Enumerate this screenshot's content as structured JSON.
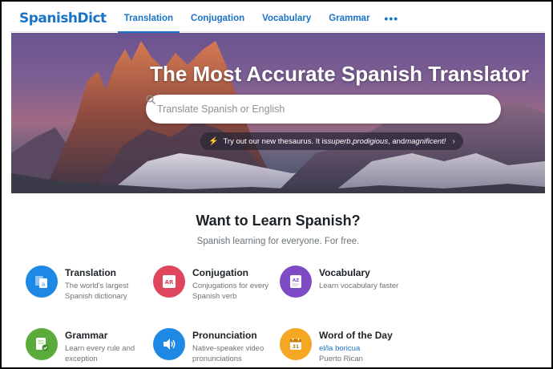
{
  "nav": {
    "logo": "SpanishDict",
    "items": [
      {
        "label": "Translation",
        "active": true
      },
      {
        "label": "Conjugation",
        "active": false
      },
      {
        "label": "Vocabulary",
        "active": false
      },
      {
        "label": "Grammar",
        "active": false
      }
    ],
    "more": "•••"
  },
  "hero": {
    "title": "The Most Accurate Spanish Translator",
    "search_placeholder": "Translate Spanish or English",
    "promo_prefix": "Try out our new thesaurus. It is ",
    "promo_w1": "superb",
    "promo_sep1": ", ",
    "promo_w2": "prodigious",
    "promo_sep2": ", and ",
    "promo_w3": "magnificent!",
    "promo_icon": "bolt-icon"
  },
  "learn": {
    "title": "Want to Learn Spanish?",
    "subtitle": "Spanish learning for everyone. For free."
  },
  "features": [
    {
      "name": "Translation",
      "desc1": "The world's largest",
      "desc2": "Spanish dictionary",
      "color": "#1e88e5",
      "icon": "translation-icon"
    },
    {
      "name": "Conjugation",
      "desc1": "Conjugations for every",
      "desc2": "Spanish verb",
      "color": "#e0455e",
      "icon": "conjugation-icon"
    },
    {
      "name": "Vocabulary",
      "desc1": "Learn vocabulary faster",
      "desc2": "",
      "color": "#7e4bc4",
      "icon": "vocabulary-icon"
    },
    {
      "name": "Grammar",
      "desc1": "Learn every rule and",
      "desc2": "exception",
      "color": "#5aab3c",
      "icon": "grammar-icon"
    },
    {
      "name": "Pronunciation",
      "desc1": "Native-speaker video",
      "desc2": "pronunciations",
      "color": "#1e88e5",
      "icon": "pronunciation-icon"
    },
    {
      "name": "Word of the Day",
      "desc1": "el/la boricua",
      "desc2": "Puerto Rican",
      "color": "#f5a623",
      "icon": "calendar-icon"
    }
  ],
  "icon_text": {
    "conjugation": "AR",
    "vocabulary": "AZ",
    "calendar": "31",
    "translation": "a"
  }
}
